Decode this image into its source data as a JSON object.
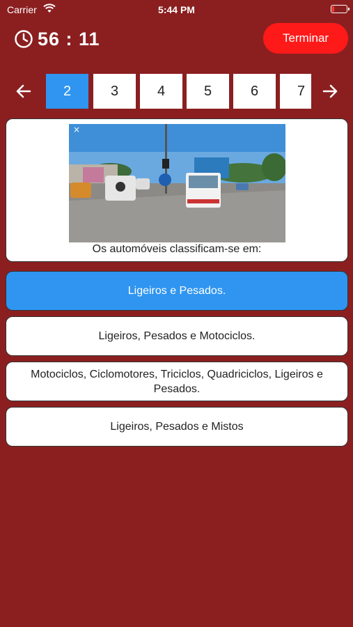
{
  "status_bar": {
    "carrier": "Carrier",
    "time": "5:44 PM"
  },
  "header": {
    "timer": "56 : 11",
    "finish_label": "Terminar"
  },
  "pager": {
    "pages": [
      "2",
      "3",
      "4",
      "5",
      "6",
      "7"
    ],
    "active_page": "2"
  },
  "question": {
    "text": "Os automóveis classificam-se em:",
    "image": "road-traffic-photo"
  },
  "answers": [
    {
      "label": "Ligeiros e Pesados.",
      "selected": true
    },
    {
      "label": "Ligeiros, Pesados e Motociclos.",
      "selected": false
    },
    {
      "label": "Motociclos, Ciclomotores, Triciclos, Quadriciclos, Ligeiros e Pesados.",
      "selected": false
    },
    {
      "label": "Ligeiros, Pesados e Mistos",
      "selected": false
    }
  ],
  "colors": {
    "background": "#8b1f20",
    "accent": "#2f95f0",
    "finish": "#ff1a1a"
  }
}
